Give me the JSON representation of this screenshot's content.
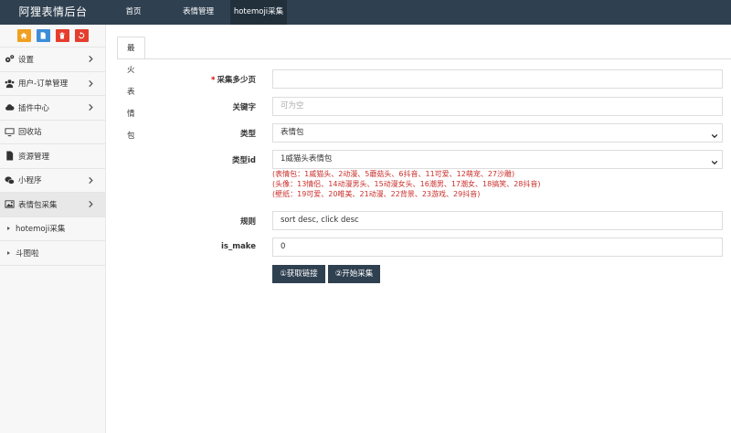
{
  "brand": "阿狸表情后台",
  "topnav": [
    {
      "label": "首页",
      "active": false
    },
    {
      "label": "表情管理",
      "active": false
    },
    {
      "label": "hotemoji采集",
      "active": true
    }
  ],
  "colors": {
    "topbar": "#2f4050",
    "home": "#f0a020",
    "file": "#3c8dd8",
    "trash": "#e53e2e",
    "recycle": "#e53e2e",
    "button": "#2f4050",
    "hint": "#c9302c"
  },
  "quick_buttons": [
    {
      "icon": "home-icon"
    },
    {
      "icon": "file-icon"
    },
    {
      "icon": "trash-icon"
    },
    {
      "icon": "recycle-icon"
    }
  ],
  "sidebar": {
    "items": [
      {
        "label": "设置",
        "icon": "gears-icon",
        "has_arrow": true
      },
      {
        "label": "用户-订单管理",
        "icon": "users-icon",
        "has_arrow": true
      },
      {
        "label": "插件中心",
        "icon": "cloud-icon",
        "has_arrow": true
      },
      {
        "label": "回收站",
        "icon": "monitor-icon",
        "has_arrow": false
      },
      {
        "label": "资源管理",
        "icon": "file-icon",
        "has_arrow": false
      },
      {
        "label": "小程序",
        "icon": "wechat-icon",
        "has_arrow": true
      },
      {
        "label": "表情包采集",
        "icon": "image-icon",
        "has_arrow": true,
        "active": true
      }
    ],
    "subitems": [
      {
        "label": "hotemoji采集"
      },
      {
        "label": "斗图啦"
      }
    ]
  },
  "tab": {
    "label": "最火表情包"
  },
  "form": {
    "pages": {
      "label": "采集多少页",
      "required_mark": "*",
      "value": ""
    },
    "keyword": {
      "label": "关键字",
      "placeholder": "可为空"
    },
    "type": {
      "label": "类型",
      "value": "表情包"
    },
    "type_id": {
      "label": "类型id",
      "value": "1威猫头表情包"
    },
    "hints": [
      "(表情包：1威猫头、2动漫、5蘑菇头、6抖音、11可爱、12萌宠、27沙雕)",
      "(头像：13情侣、14动漫男头、15动漫女头、16潮男、17潮女、18搞笑、28抖音)",
      "(壁纸：19可爱、20唯美、21动漫、22背景、23游戏、29抖音)"
    ],
    "rule": {
      "label": "规则",
      "value": "sort desc, click desc"
    },
    "is_make": {
      "label": "is_make",
      "value": "0"
    }
  },
  "buttons": {
    "get_links": "①获取链接",
    "start": "②开始采集"
  }
}
